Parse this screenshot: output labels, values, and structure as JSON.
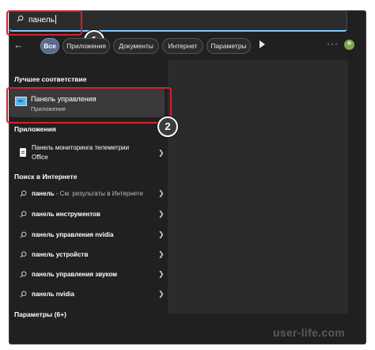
{
  "search": {
    "value": "панель"
  },
  "badges": {
    "one": "1",
    "two": "2"
  },
  "filters": {
    "items": [
      "Все",
      "Приложения",
      "Документы",
      "Интернет",
      "Параметры"
    ]
  },
  "sections": {
    "best_match": "Лучшее соответствие",
    "apps": "Приложения",
    "web": "Поиск в Интернете",
    "settings": "Параметры (6+)"
  },
  "best_match": {
    "name": "Панель управления",
    "type": "Приложение"
  },
  "apps": [
    {
      "line1": "Панель мониторинга телеметрии",
      "line2": "Office"
    }
  ],
  "web_results": [
    {
      "bold": "панель",
      "rest": " - См. результаты в Интернете"
    },
    {
      "bold": "панель инструментов",
      "rest": ""
    },
    {
      "bold": "панель управления nvidia",
      "rest": ""
    },
    {
      "bold": "панель устройств",
      "rest": ""
    },
    {
      "bold": "панель управления звуком",
      "rest": ""
    },
    {
      "bold": "панель nvidia",
      "rest": ""
    }
  ],
  "watermark": "user-life.com",
  "colors": {
    "highlight": "#d9202a",
    "accent": "#7cc8ff",
    "active_chip": "#5a6a8a"
  }
}
